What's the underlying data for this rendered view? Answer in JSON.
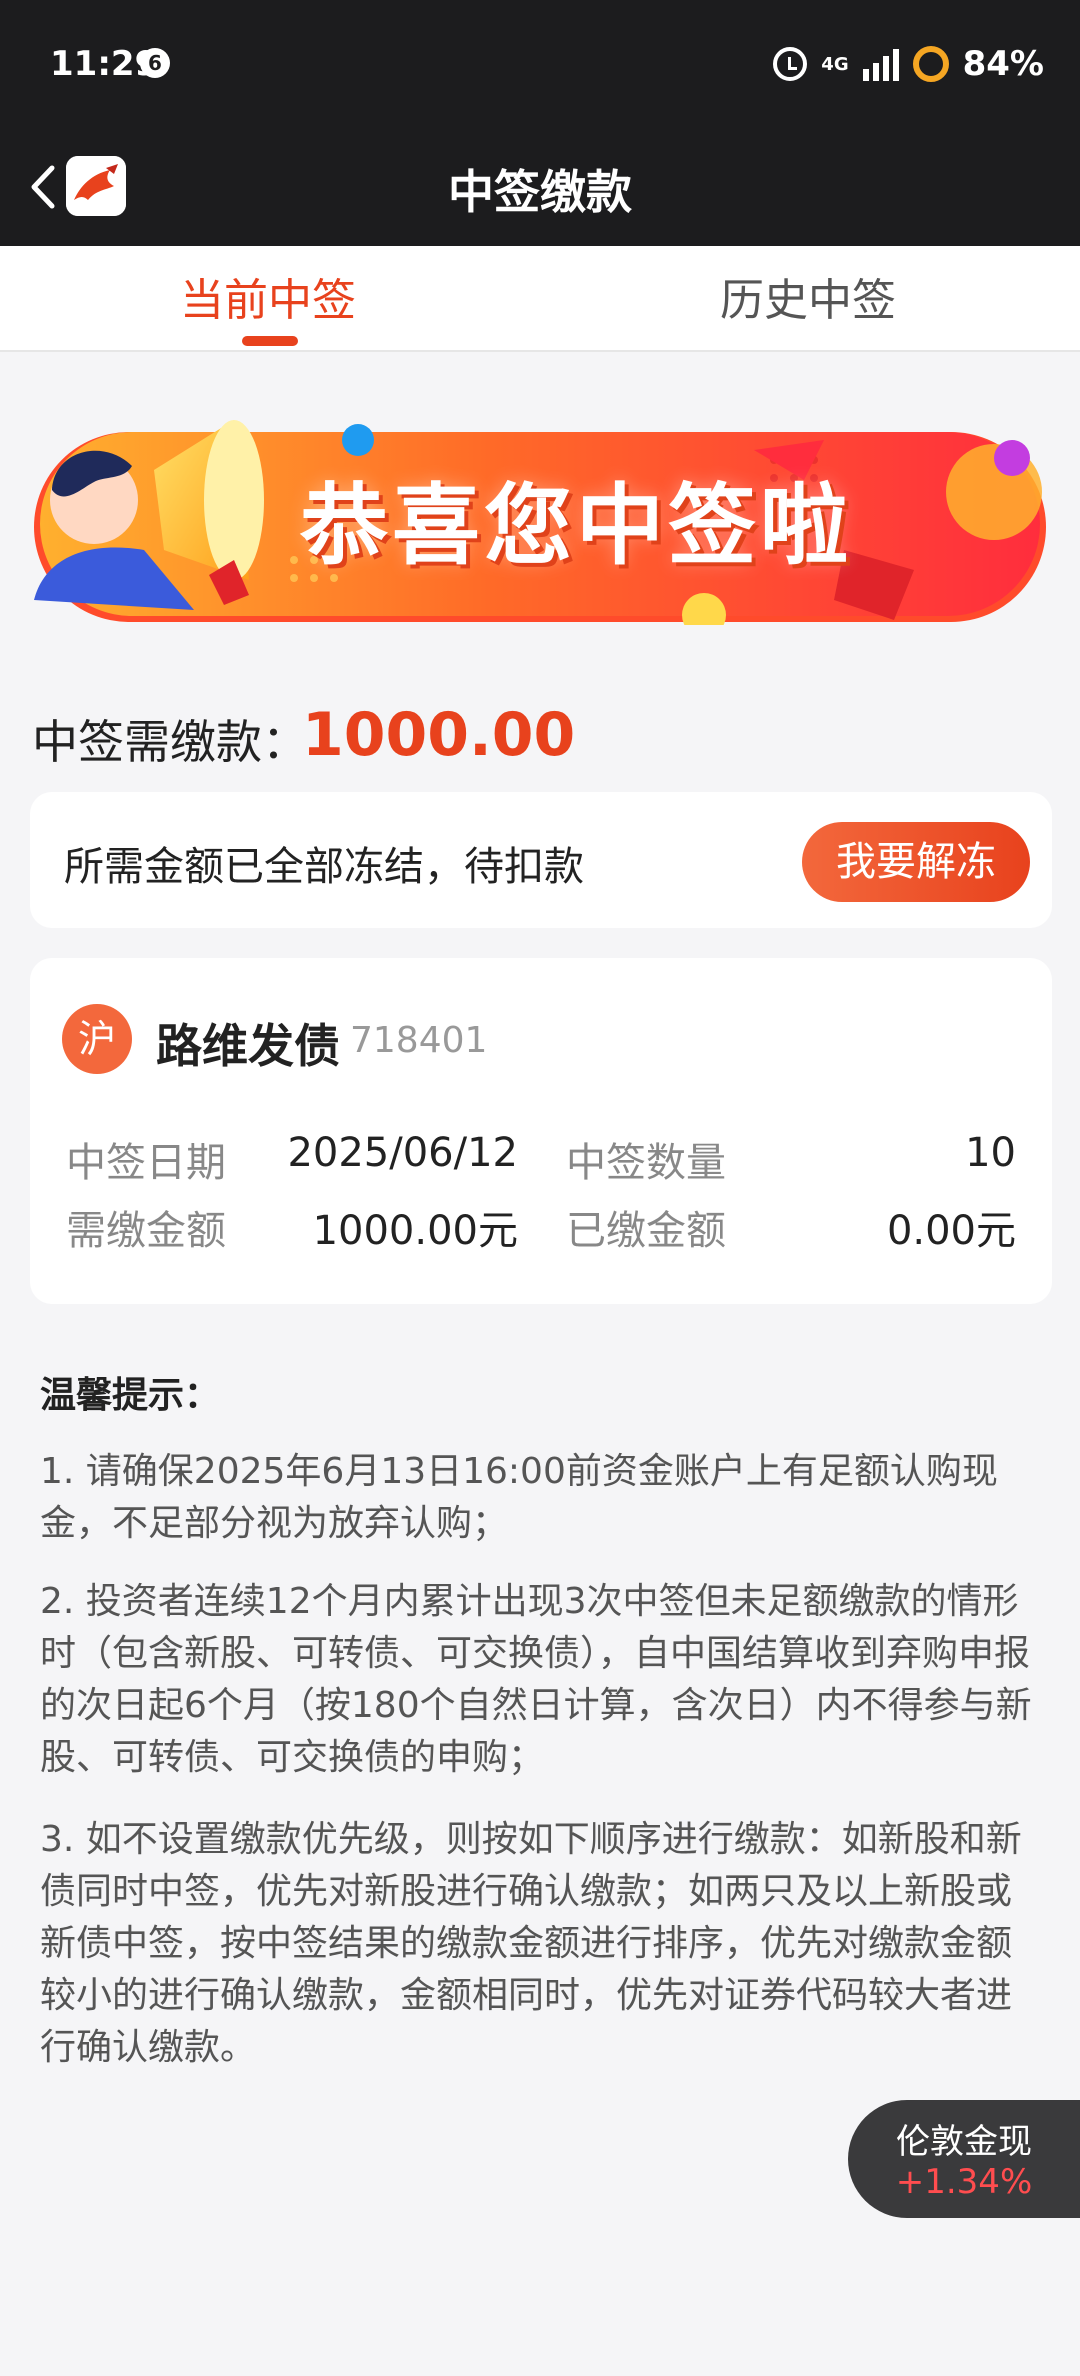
{
  "status": {
    "time": "11:29",
    "notification_count": "6",
    "battery": "84%",
    "network": "4G"
  },
  "nav": {
    "title": "中签缴款",
    "logo": "app-logo"
  },
  "tabs": [
    {
      "label": "当前中签",
      "active": true
    },
    {
      "label": "历史中签",
      "active": false
    }
  ],
  "banner": {
    "text": "恭喜您中签啦"
  },
  "due": {
    "label": "中签需缴款：",
    "amount": "1000.00"
  },
  "frozen": {
    "message": "所需金额已全部冻结，待扣款",
    "button": "我要解冻"
  },
  "bond": {
    "exchange": "沪",
    "name": "路维发债",
    "code": "718401",
    "fields": [
      {
        "label": "中签日期",
        "value": "2025/06/12"
      },
      {
        "label": "中签数量",
        "value": "10"
      },
      {
        "label": "需缴金额",
        "value": "1000.00元"
      },
      {
        "label": "已缴金额",
        "value": "0.00元"
      }
    ]
  },
  "tips": {
    "title": "温馨提示：",
    "items": [
      "1. 请确保2025年6月13日16:00前资金账户上有足额认购现金，不足部分视为放弃认购；",
      "2. 投资者连续12个月内累计出现3次中签但未足额缴款的情形时（包含新股、可转债、可交换债），自中国结算收到弃购申报的次日起6个月（按180个自然日计算，含次日）内不得参与新股、可转债、可交换债的申购；",
      "3. 如不设置缴款优先级，则按如下顺序进行缴款：如新股和新债同时中签，优先对新股进行确认缴款；如两只及以上新股或新债中签，按中签结果的缴款金额进行排序，优先对缴款金额较小的进行确认缴款，金额相同时，优先对证券代码较大者进行确认缴款。"
    ]
  },
  "widget": {
    "name": "伦敦金现",
    "change": "+1.34%"
  },
  "colors": {
    "accent": "#e8421d",
    "dark_bar": "#1c1c1e",
    "positive": "#ff4d4f"
  }
}
